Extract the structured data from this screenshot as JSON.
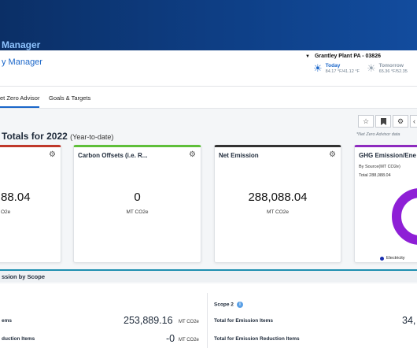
{
  "header": {
    "app_name": "Manager",
    "subtitle": "y Manager",
    "site": "Grantley Plant PA - 03826",
    "weather": [
      {
        "day": "Today",
        "temp": "84.17 °F/41.12 °F",
        "icon": "sun-icon"
      },
      {
        "day": "Tomorrow",
        "temp": "65.36 °F/52.35",
        "icon": "sun-icon"
      }
    ]
  },
  "tabs": [
    {
      "label": "et Zero Advisor",
      "active": true
    },
    {
      "label": "Goals & Targets",
      "active": false
    }
  ],
  "totals": {
    "title": "Totals for 2022",
    "ytd": "(Year-to-date)",
    "note": "*Net Zero Advisor data"
  },
  "toolbar": [
    "star-icon",
    "bookmark-icon",
    "gear-icon",
    "more-icon"
  ],
  "cards": [
    {
      "title": "",
      "value": "88.04",
      "unit": "O2e",
      "accent": "#c0392b"
    },
    {
      "title": "Carbon Offsets (i.e. R...",
      "value": "0",
      "unit": "MT CO2e",
      "accent": "#5fbf3a"
    },
    {
      "title": "Net Emission",
      "value": "288,088.04",
      "unit": "MT CO2e",
      "accent": "#333333"
    },
    {
      "title": "GHG Emission/Ene",
      "subtitle": "By Source(MT CO2e)",
      "total": "Total 288,088.04",
      "legend": "Electricity",
      "accent": "#8e2bbf"
    }
  ],
  "scope": {
    "band_label": "ssion by Scope",
    "left": {
      "row1_label": "ems",
      "row1_value": "253,889.16",
      "row1_unit": "MT CO2e",
      "row2_label": "duction Items",
      "row2_value": "-0",
      "row2_unit": "MT CO2e"
    },
    "right": {
      "heading": "Scope 2",
      "row1_label": "Total for Emission Items",
      "row1_value": "34,",
      "row2_label": "Total for Emission Reduction Items"
    }
  }
}
